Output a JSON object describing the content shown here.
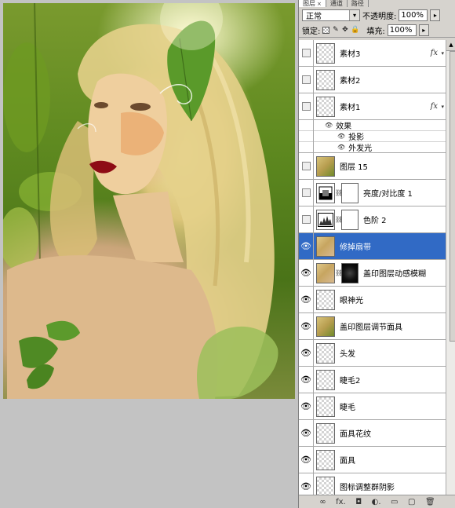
{
  "panel": {
    "tabs": [
      {
        "label": "图层",
        "close": "×"
      },
      {
        "label": "通道"
      },
      {
        "label": "路径"
      }
    ],
    "blend_mode": "正常",
    "opacity_label": "不透明度:",
    "opacity_value": "100%",
    "lock_label": "锁定:",
    "fill_label": "填充:",
    "fill_value": "100%",
    "arrow": "▸",
    "dropdown_arrow": "▾"
  },
  "layers": [
    {
      "name": "素材3",
      "visible": false,
      "fx": "fx"
    },
    {
      "name": "素材2",
      "visible": false
    },
    {
      "name": "素材1",
      "visible": false,
      "fx": "fx"
    },
    {
      "name": "图层 15",
      "visible": false
    },
    {
      "name": "亮度/对比度 1",
      "visible": false
    },
    {
      "name": "色阶 2",
      "visible": false
    },
    {
      "name": "修掉扇带",
      "visible": true,
      "selected": true
    },
    {
      "name": "盖印图层动感模糊",
      "visible": true
    },
    {
      "name": "眼神光",
      "visible": true
    },
    {
      "name": "盖印图层调节面具",
      "visible": true
    },
    {
      "name": "头发",
      "visible": true
    },
    {
      "name": "睫毛2",
      "visible": true
    },
    {
      "name": "睫毛",
      "visible": true
    },
    {
      "name": "面具花纹",
      "visible": true
    },
    {
      "name": "面具",
      "visible": true
    },
    {
      "name": "图标调整群阴影",
      "visible": true
    }
  ],
  "effects": {
    "header": "效果",
    "items": [
      "投影",
      "外发光"
    ]
  },
  "icons": {
    "eye": "eye-icon",
    "chain": "link-icon",
    "lock_transparent": "lock-transparent-icon",
    "lock_paint": "brush-icon",
    "lock_move": "move-icon",
    "lock_all": "lock-icon",
    "fx": "fx-icon"
  },
  "bottom_bar": {
    "link": "∞",
    "fx": "fx.",
    "mask": "◘",
    "adjust": "◐.",
    "group": "▭",
    "new": "▢",
    "delete": "🗑"
  }
}
